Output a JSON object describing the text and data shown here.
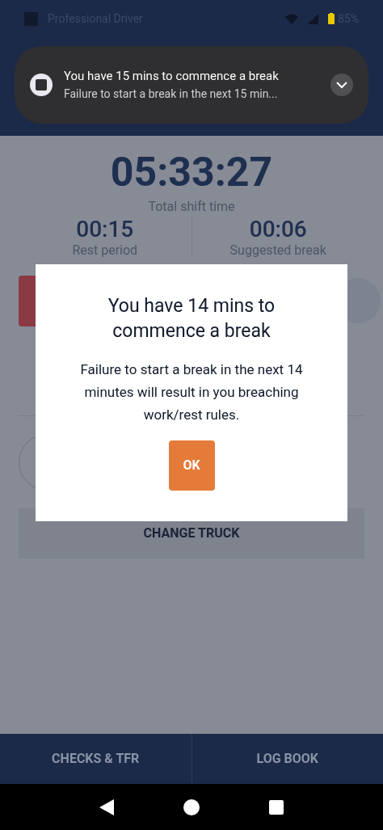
{
  "status_bar": {
    "app_name": "Professional Driver",
    "battery": "85%"
  },
  "notification": {
    "title": "You have 15 mins to commence a break",
    "text": "Failure to start a break in the next 15 min..."
  },
  "shift": {
    "total": "05:33:27",
    "total_label": "Total shift time",
    "stats": [
      {
        "value": "00:15",
        "label": "Rest period"
      },
      {
        "value": "00:06",
        "label": "Suggested break"
      }
    ]
  },
  "change_truck": "CHANGE TRUCK",
  "dialog": {
    "title": "You have 14 mins to commence a break",
    "message": "Failure to start a break in the next 14 minutes will result in you breaching work/rest rules.",
    "button": "OK"
  },
  "bottom_tabs": [
    {
      "label": "CHECKS & TFR"
    },
    {
      "label": "LOG BOOK"
    }
  ]
}
